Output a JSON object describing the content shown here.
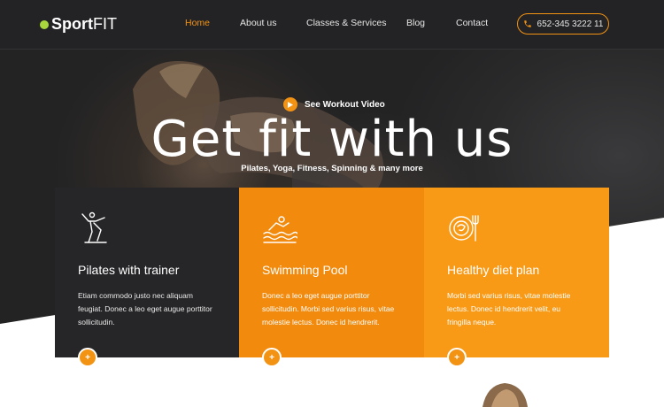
{
  "logo": {
    "bold": "Sport",
    "light": "FIT"
  },
  "nav": [
    {
      "label": "Home",
      "active": true
    },
    {
      "label": "About us",
      "active": false
    },
    {
      "label": "Classes & Services",
      "active": false
    },
    {
      "label": "Blog",
      "active": false
    },
    {
      "label": "Contact",
      "active": false
    }
  ],
  "phone": {
    "number": "652-345 3222 11",
    "icon": "phone-icon"
  },
  "hero": {
    "video_label": "See Workout Video",
    "title": "Get fit with us",
    "subtitle": "Pilates, Yoga, Fitness, Spinning & many more"
  },
  "cards": [
    {
      "title": "Pilates with trainer",
      "text": "Etiam commodo justo nec aliquam feugiat. Donec a leo eget augue porttitor sollicitudin.",
      "icon": "pilates-icon",
      "button": "+"
    },
    {
      "title": "Swimming Pool",
      "text": "Donec a leo eget augue porttitor sollicitudin. Morbi sed varius risus, vitae molestie lectus. Donec id hendrerit.",
      "icon": "swimming-icon",
      "button": "+"
    },
    {
      "title": "Healthy diet plan",
      "text": "Morbi sed varius risus, vitae molestie lectus. Donec id hendrerit velit, eu fringilla neque.",
      "icon": "diet-plate-icon",
      "button": "+"
    }
  ],
  "colors": {
    "accent": "#f39313",
    "header_bg": "#232325",
    "card_dark": "#262628",
    "card_orange": "#f18a0d",
    "card_light_orange": "#f99a17",
    "logo_dot": "#a8d63c"
  }
}
